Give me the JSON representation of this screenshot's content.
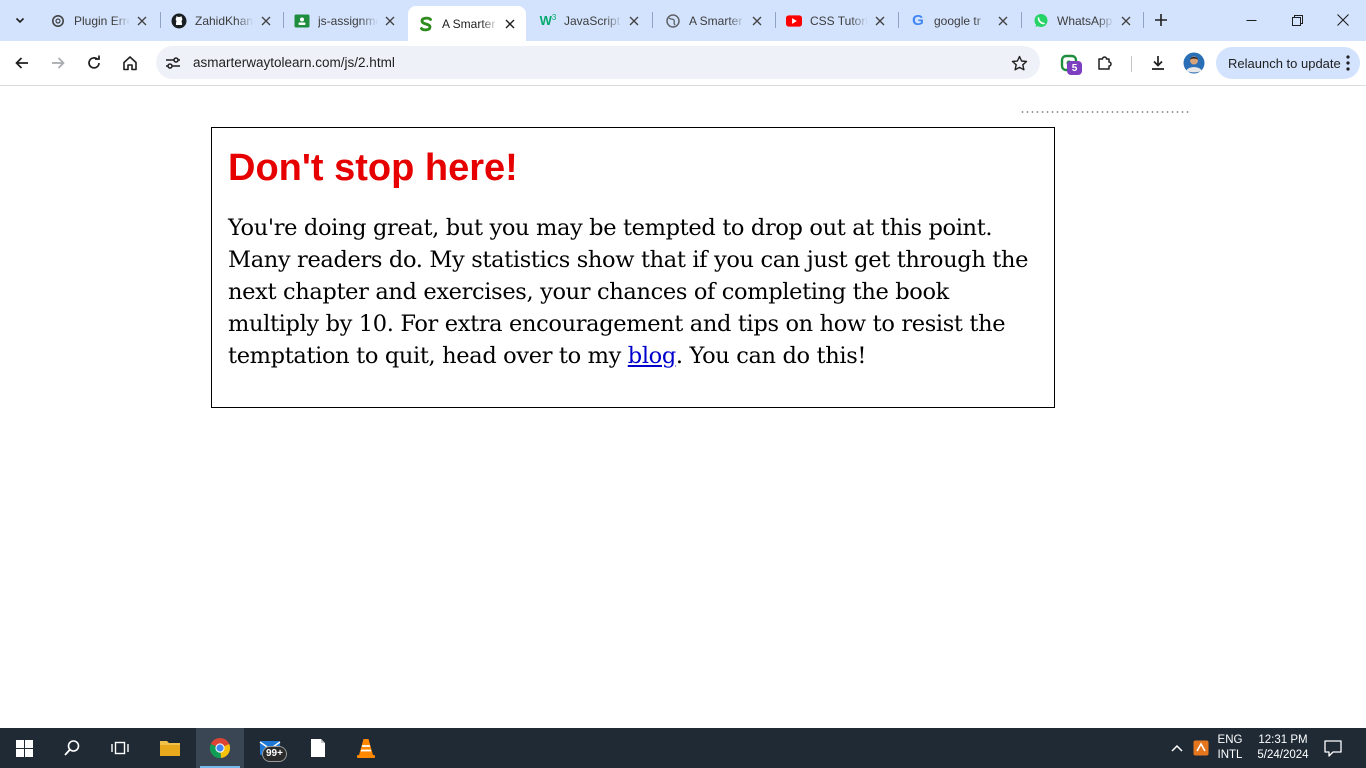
{
  "tabs": [
    {
      "title": "Plugin Error",
      "icon": "openai-icon"
    },
    {
      "title": "ZahidKhan",
      "icon": "github-icon"
    },
    {
      "title": "js-assignment",
      "icon": "google-classroom-icon"
    },
    {
      "title": "A Smarter",
      "icon": "smarter-s-icon",
      "active": true
    },
    {
      "title": "JavaScript",
      "icon": "w3schools-icon"
    },
    {
      "title": "A Smarter",
      "icon": "globe-icon"
    },
    {
      "title": "CSS Tutorial",
      "icon": "youtube-icon"
    },
    {
      "title": "google tr",
      "icon": "google-icon"
    },
    {
      "title": "WhatsApp",
      "icon": "whatsapp-icon"
    }
  ],
  "toolbar": {
    "url": "asmarterwaytolearn.com/js/2.html",
    "relaunch_label": "Relaunch to update",
    "extension_badge": "5"
  },
  "page": {
    "heading": "Don't stop here!",
    "body_before_link": "You're doing great, but you may be tempted to drop out at this point. Many readers do. My statistics show that if you can just get through the next chapter and exercises, your chances of completing the book multiply by 10. For extra encouragement and tips on how to resist the temptation to quit, head over to my ",
    "link_text": "blog",
    "body_after_link": ". You can do this!"
  },
  "taskbar": {
    "mail_badge": "99+",
    "language": "ENG",
    "layout": "INTL",
    "time": "12:31 PM",
    "date": "5/24/2024"
  },
  "colors": {
    "heading": "#e60000",
    "link": "#0000cc",
    "tabstrip": "#d3e3fd",
    "taskbar": "#1f2a35"
  }
}
